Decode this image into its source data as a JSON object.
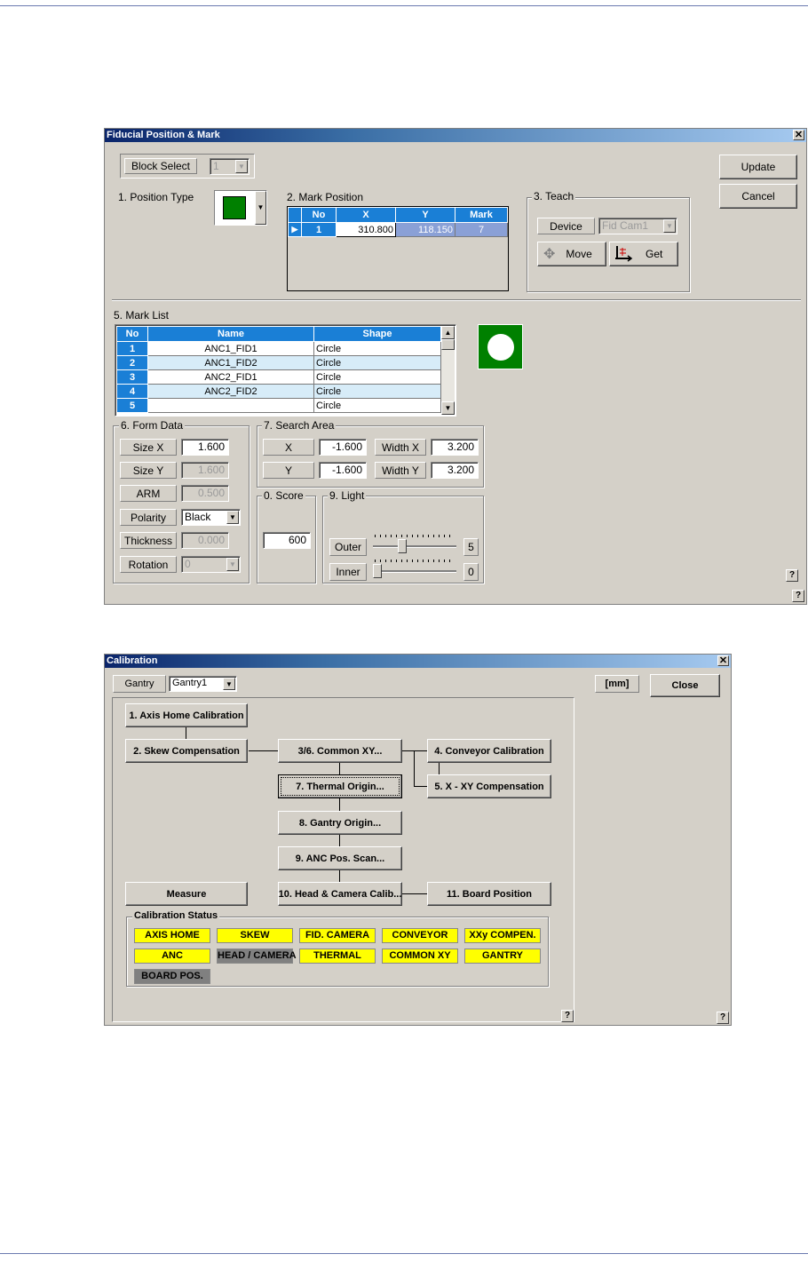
{
  "fiducial": {
    "title": "Fiducial Position & Mark",
    "close_glyph": "✕",
    "block_select_label": "Block Select",
    "block_select_value": "1",
    "position_type_label": "1. Position Type",
    "mark_position_label": "2. Mark Position",
    "mark_position_table": {
      "headers": [
        "No",
        "X",
        "Y",
        "Mark"
      ],
      "row": {
        "no": "1",
        "x": "310.800",
        "y": "118.150",
        "mark": "7"
      }
    },
    "teach": {
      "label": "3. Teach",
      "device_label": "Device",
      "device_value": "Fid Cam1",
      "move_label": "Move",
      "get_label": "Get"
    },
    "update_label": "Update",
    "cancel_label": "Cancel",
    "mark_list": {
      "label": "5. Mark List",
      "headers": [
        "No",
        "Name",
        "Shape"
      ],
      "rows": [
        {
          "no": "1",
          "name": "ANC1_FID1",
          "shape": "Circle"
        },
        {
          "no": "2",
          "name": "ANC1_FID2",
          "shape": "Circle"
        },
        {
          "no": "3",
          "name": "ANC2_FID1",
          "shape": "Circle"
        },
        {
          "no": "4",
          "name": "ANC2_FID2",
          "shape": "Circle"
        },
        {
          "no": "5",
          "name": "",
          "shape": "Circle"
        }
      ]
    },
    "form_data": {
      "label": "6. Form Data",
      "size_x_label": "Size X",
      "size_x": "1.600",
      "size_y_label": "Size Y",
      "size_y": "1.600",
      "arm_label": "ARM",
      "arm": "0.500",
      "polarity_label": "Polarity",
      "polarity": "Black",
      "thickness_label": "Thickness",
      "thickness": "0.000",
      "rotation_label": "Rotation",
      "rotation": "0"
    },
    "search_area": {
      "label": "7. Search Area",
      "x_label": "X",
      "x": "-1.600",
      "y_label": "Y",
      "y": "-1.600",
      "width_x_label": "Width X",
      "width_x": "3.200",
      "width_y_label": "Width Y",
      "width_y": "3.200"
    },
    "score": {
      "label": "0. Score",
      "value": "600"
    },
    "light": {
      "label": "9. Light",
      "outer_label": "Outer",
      "outer_value": "5",
      "outer_fraction": 0.33,
      "inner_label": "Inner",
      "inner_value": "0",
      "inner_fraction": 0.0
    },
    "help_glyph": "?",
    "colors": {
      "mark_green": "#008000",
      "header_blue": "#1a7fd6"
    }
  },
  "calibration": {
    "title": "Calibration",
    "close_glyph": "✕",
    "gantry_label": "Gantry",
    "gantry_value": "Gantry1",
    "unit_label": "[mm]",
    "close_label": "Close",
    "buttons": {
      "axis_home": "1. Axis Home Calibration",
      "skew": "2. Skew Compensation",
      "common_xy": "3/6. Common XY...",
      "conveyor": "4. Conveyor Calibration",
      "x_xy": "5. X - XY Compensation",
      "thermal": "7. Thermal Origin...",
      "gantry_origin": "8. Gantry Origin...",
      "anc_scan": "9. ANC Pos. Scan...",
      "head_camera": "10. Head & Camera Calib...",
      "board_position": "11. Board Position",
      "measure": "Measure"
    },
    "status": {
      "label": "Calibration Status",
      "items": [
        {
          "text": "AXIS HOME",
          "state": "yellow"
        },
        {
          "text": "SKEW",
          "state": "yellow"
        },
        {
          "text": "FID. CAMERA",
          "state": "yellow"
        },
        {
          "text": "CONVEYOR",
          "state": "yellow"
        },
        {
          "text": "XXy COMPEN.",
          "state": "yellow"
        },
        {
          "text": "ANC",
          "state": "yellow"
        },
        {
          "text": "HEAD / CAMERA",
          "state": "gray"
        },
        {
          "text": "THERMAL",
          "state": "yellow"
        },
        {
          "text": "COMMON XY",
          "state": "yellow"
        },
        {
          "text": "GANTRY",
          "state": "yellow"
        },
        {
          "text": "BOARD POS.",
          "state": "gray"
        }
      ]
    },
    "help_glyph": "?",
    "colors": {
      "ok": "#ffff00",
      "pending": "#808080"
    }
  }
}
